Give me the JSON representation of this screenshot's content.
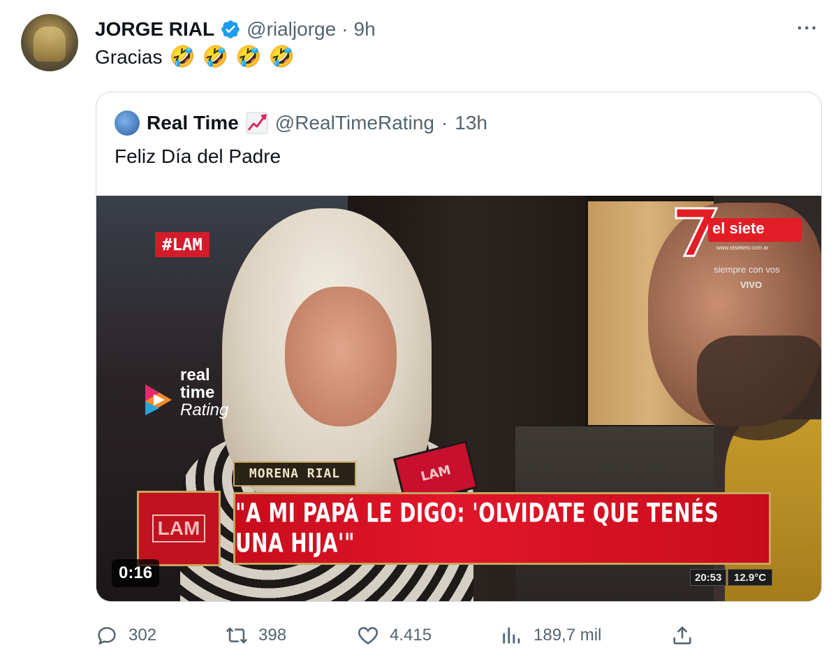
{
  "tweet": {
    "author_name": "JORGE RIAL",
    "handle": "@rialjorge",
    "separator": "·",
    "time": "9h",
    "more": "···",
    "text": "Gracias",
    "emojis": [
      "🤣",
      "🤣",
      "🤣",
      "🤣"
    ]
  },
  "quote": {
    "author_name": "Real Time",
    "handle": "@RealTimeRating",
    "separator": "·",
    "time": "13h",
    "text": "Feliz Día del Padre",
    "video": {
      "hashtag": "#LAM",
      "watermark_line1": "real",
      "watermark_line2": "time",
      "watermark_line3": "Rating",
      "channel_name": "el siete",
      "channel_url": "www.elsietetv.com.ar",
      "channel_slogan": "siempre con vos",
      "channel_live": "VIVO",
      "name_plate": "MORENA RIAL",
      "lam_logo": "LAM",
      "mic_label": "LAM",
      "headline": "\"A MI PAPÁ LE DIGO: 'OLVIDATE QUE TENÉS UNA HIJA'\"",
      "duration": "0:16",
      "clock": "20:53",
      "temperature": "12.9°C"
    }
  },
  "actions": {
    "replies": "302",
    "retweets": "398",
    "likes": "4.415",
    "views": "189,7 mil"
  },
  "colors": {
    "text": "#0f1419",
    "secondary": "#536471",
    "verified": "#1d9bf0",
    "border": "#cfd9de",
    "lam_red": "#d21b2b"
  }
}
